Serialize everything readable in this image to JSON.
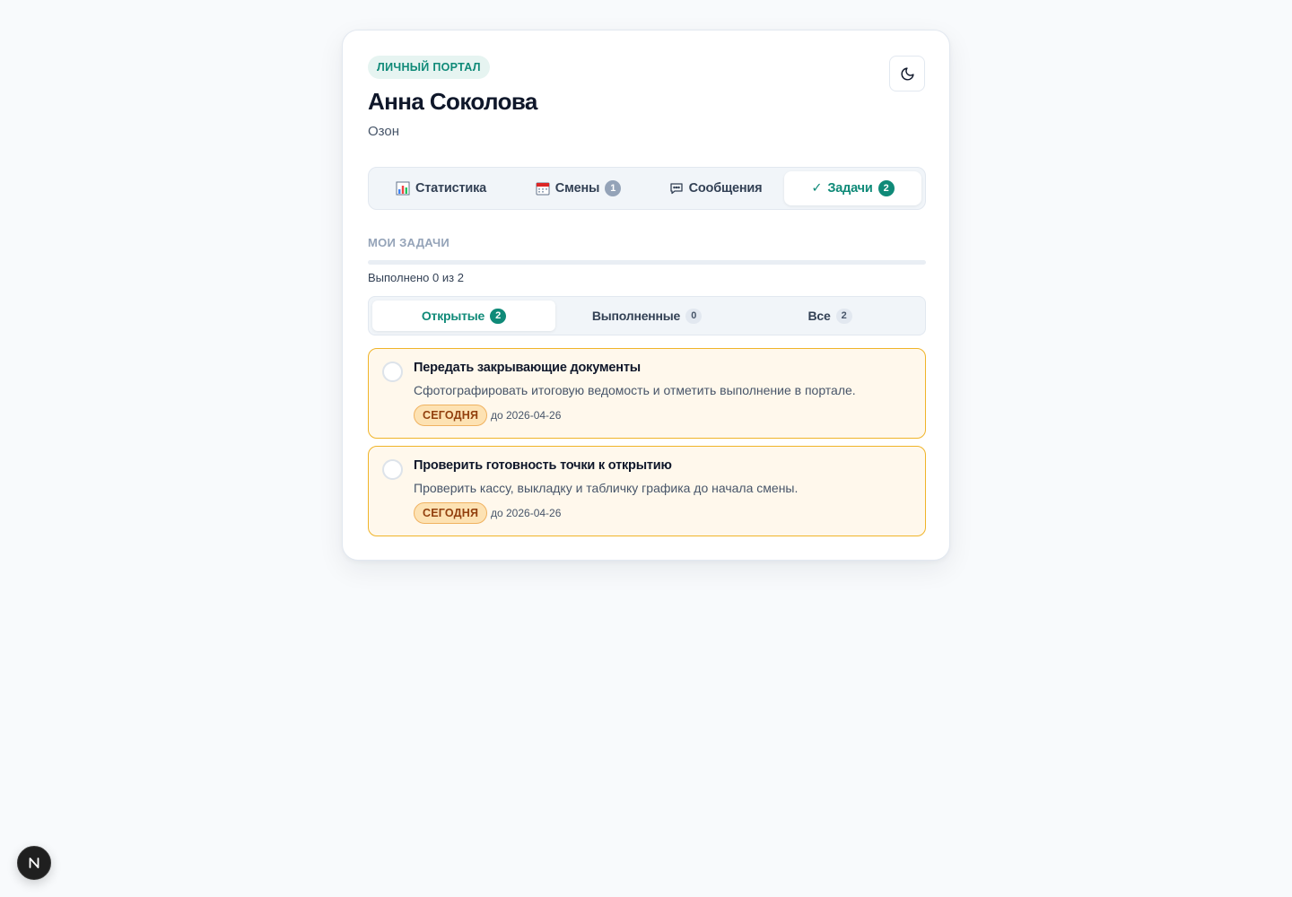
{
  "header": {
    "badge": "ЛИЧНЫЙ ПОРТАЛ",
    "name": "Анна Соколова",
    "company": "Озон",
    "theme_toggle_icon": "moon-icon"
  },
  "main_tabs": [
    {
      "label": "Статистика",
      "icon": "chart-icon",
      "count": null,
      "active": false
    },
    {
      "label": "Смены",
      "icon": "calendar-icon",
      "count": "1",
      "active": false
    },
    {
      "label": "Сообщения",
      "icon": "message-icon",
      "count": null,
      "active": false
    },
    {
      "label": "Задачи",
      "icon": "check-icon",
      "check_glyph": "✓",
      "count": "2",
      "active": true
    }
  ],
  "tasks_section": {
    "title": "МОИ ЗАДАЧИ",
    "progress_text": "Выполнено 0 из 2",
    "progress_fraction": 0,
    "filters": [
      {
        "label": "Открытые",
        "count": "2",
        "active": true
      },
      {
        "label": "Выполненные",
        "count": "0",
        "active": false
      },
      {
        "label": "Все",
        "count": "2",
        "active": false
      }
    ],
    "items": [
      {
        "title": "Передать закрывающие документы",
        "description": "Сфотографировать итоговую ведомость и отметить выполнение в портале.",
        "due_badge": "СЕГОДНЯ",
        "due_date": "до 2026-04-26",
        "done": false
      },
      {
        "title": "Проверить готовность точки к открытию",
        "description": "Проверить кассу, выкладку и табличку графика до начала смены.",
        "due_badge": "СЕГОДНЯ",
        "due_date": "до 2026-04-26",
        "done": false
      }
    ]
  },
  "dev_indicator": {
    "letter": "N"
  },
  "colors": {
    "accent": "#0f8a78",
    "page_bg": "#f8fafc",
    "task_bg": "#fff8ec",
    "task_border": "#f0b429",
    "due_badge_bg": "#fde2b3",
    "due_badge_text": "#92400e"
  }
}
